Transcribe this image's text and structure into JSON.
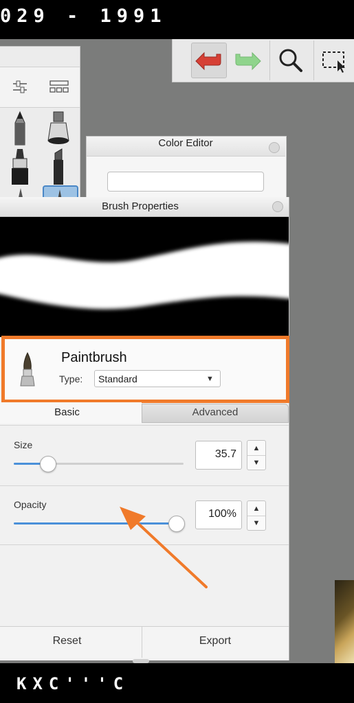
{
  "video_overlay": {
    "top_text": "029 - 1991",
    "bottom_text": "KXC'''C"
  },
  "toolbar": {
    "undo_icon": "undo-arrow-icon",
    "redo_icon": "redo-arrow-icon",
    "zoom_icon": "magnifier-icon",
    "select_icon": "selection-icon"
  },
  "color_editor": {
    "title": "Color Editor",
    "field_value": ""
  },
  "brush_properties": {
    "title": "Brush Properties",
    "brush_name": "Paintbrush",
    "type_label": "Type:",
    "type_value": "Standard",
    "tabs": [
      {
        "label": "Basic",
        "active": true
      },
      {
        "label": "Advanced",
        "active": false
      }
    ],
    "size": {
      "label": "Size",
      "value": "35.7",
      "fraction": 0.2
    },
    "opacity": {
      "label": "Opacity",
      "value": "100%",
      "fraction": 1.0
    },
    "buttons": {
      "reset": "Reset",
      "export": "Export"
    }
  },
  "colors": {
    "highlight": "#f07a2a",
    "slider_fill": "#4a90d9",
    "undo_red": "#d64035",
    "redo_green": "#8fd48c"
  }
}
